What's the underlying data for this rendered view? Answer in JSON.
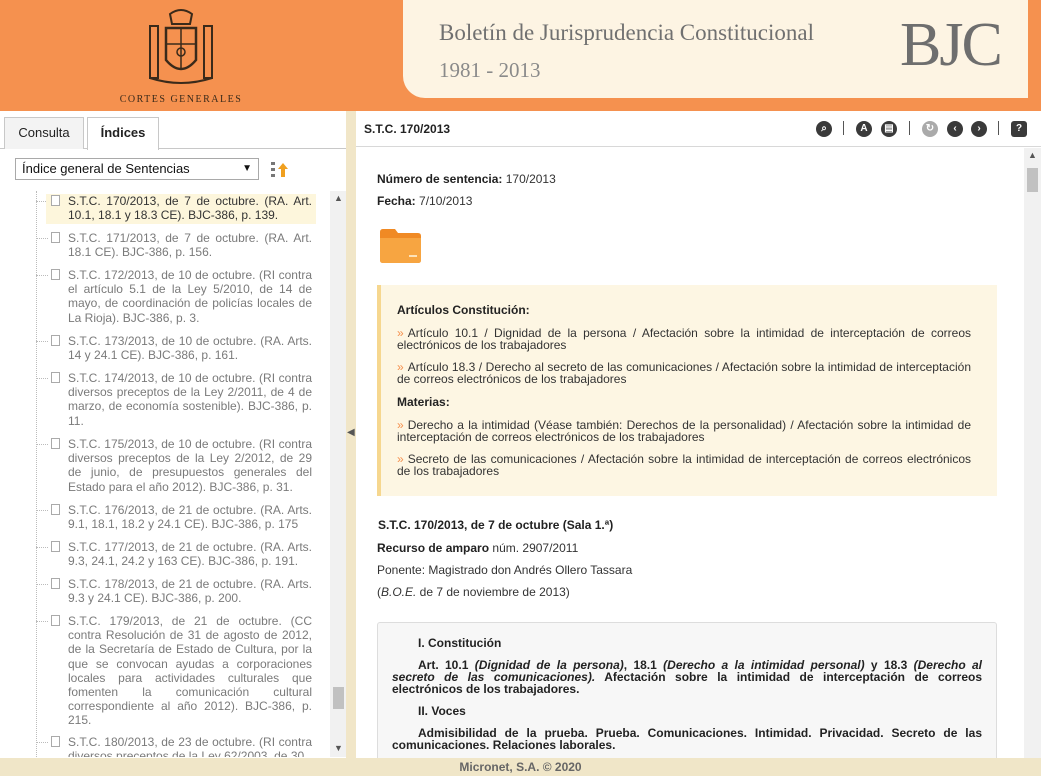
{
  "header": {
    "crest_label": "CORTES GENERALES",
    "title": "Boletín de Jurisprudencia Constitucional",
    "years": "1981 - 2013",
    "logo": "BJC"
  },
  "left_panel": {
    "tabs": [
      {
        "label": "Consulta"
      },
      {
        "label": "Índices"
      }
    ],
    "index_select": {
      "selected": "Índice general de Sentencias"
    },
    "items": [
      {
        "text": "S.T.C. 170/2013, de 7 de octubre. (RA. Art. 10.1, 18.1 y 18.3 CE). BJC-386, p. 139."
      },
      {
        "text": "S.T.C. 171/2013, de 7 de octubre. (RA. Art. 18.1 CE). BJC-386, p. 156."
      },
      {
        "text": "S.T.C. 172/2013, de 10 de octubre. (RI contra el artículo 5.1 de la Ley 5/2010, de 14 de mayo, de coordinación de policías locales de La Rioja). BJC-386, p. 3."
      },
      {
        "text": "S.T.C. 173/2013, de 10 de octubre. (RA. Arts. 14 y 24.1 CE). BJC-386, p. 161."
      },
      {
        "text": "S.T.C. 174/2013, de 10 de octubre. (RI contra diversos preceptos de la Ley 2/2011, de 4 de marzo, de economía sostenible). BJC-386, p. 11."
      },
      {
        "text": "S.T.C. 175/2013, de 10 de octubre. (RI contra diversos preceptos de la Ley 2/2012, de 29 de junio, de presupuestos generales del Estado para el año 2012). BJC-386, p. 31."
      },
      {
        "text": "S.T.C. 176/2013, de 21 de octubre. (RA. Arts. 9.1, 18.1, 18.2 y 24.1 CE). BJC-386, p. 175"
      },
      {
        "text": "S.T.C. 177/2013, de 21 de octubre. (RA. Arts. 9.3, 24.1, 24.2 y 163 CE). BJC-386, p. 191."
      },
      {
        "text": "S.T.C. 178/2013, de 21 de octubre. (RA. Arts. 9.3 y 24.1 CE). BJC-386, p. 200."
      },
      {
        "text": "S.T.C. 179/2013, de 21 de octubre. (CC contra Resolución de 31 de agosto de 2012, de la Secretaría de Estado de Cultura, por la que se convocan ayudas a corporaciones locales para actividades culturales que fomenten la comunicación cultural correspondiente al año 2012). BJC-386, p. 215."
      },
      {
        "text": "S.T.C. 180/2013, de 23 de octubre. (RI contra diversos preceptos de la Ley 62/2003, de 30"
      }
    ]
  },
  "document": {
    "title": "S.T.C. 170/2013",
    "toolbar": {
      "search": "search-icon",
      "pdf": "pdf-icon",
      "print": "print-icon",
      "refresh": "refresh-icon",
      "prev": "prev-icon",
      "next": "next-icon",
      "help": "help-icon"
    },
    "numero_label": "Número de sentencia:",
    "numero_value": "170/2013",
    "fecha_label": "Fecha:",
    "fecha_value": "7/10/2013",
    "articulos_heading": "Artículos Constitución:",
    "articulos": [
      {
        "text": "Artículo 10.1 / Dignidad de la persona / Afectación sobre la intimidad de interceptación de correos electrónicos de los trabajadores"
      },
      {
        "text": "Artículo 18.3 / Derecho al secreto de las comunicaciones / Afectación sobre la intimidad de interceptación de correos electrónicos de los trabajadores"
      }
    ],
    "materias_heading": "Materias:",
    "materias": [
      {
        "text": "Derecho a la intimidad (Véase también: Derechos de la personalidad) / Afectación sobre la intimidad de interceptación de correos electrónicos de los trabajadores"
      },
      {
        "text": "Secreto de las comunicaciones / Afectación sobre la intimidad de interceptación de correos electrónicos de los trabajadores"
      }
    ],
    "sentencia_title": "S.T.C. 170/2013, de 7 de octubre (Sala 1.ª)",
    "recurso_label": "Recurso de amparo",
    "recurso_value": "núm. 2907/2011",
    "ponente": "Ponente: Magistrado don Andrés Ollero Tassara",
    "boe_italic": "B.O.E.",
    "boe_rest": " de 7 de noviembre de 2013)",
    "boe_open": "(",
    "summary": {
      "h1": "I. Constitución",
      "art_bold_1": "Art. 10.1 ",
      "art_it_1": "(Dignidad de la persona)",
      "art_bold_2": ", 18.1 ",
      "art_it_2": "(Derecho a la intimidad personal)",
      "art_bold_3": " y 18.3 ",
      "art_it_3": "(Derecho al secreto de las comunicaciones).",
      "art_bold_4": " Afectación sobre la intimidad de interceptación de correos electrónicos de los trabajadores.",
      "h2": "II. Voces",
      "voces": "Admisibilidad de la prueba. Prueba. Comunicaciones. Intimidad. Privacidad. Secreto de las comunicaciones. Relaciones laborales."
    }
  },
  "footer": {
    "text": "Micronet, S.A. © 2020"
  }
}
